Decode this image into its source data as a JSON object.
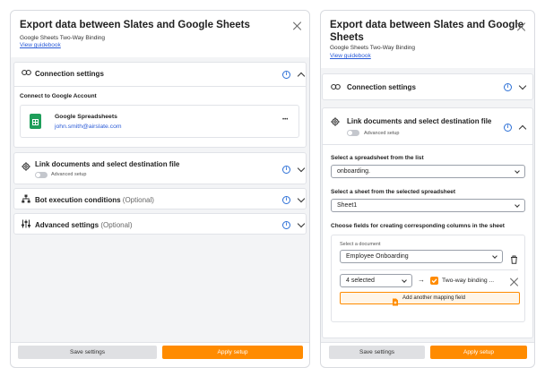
{
  "colors": {
    "accent": "#ff8b00",
    "link": "#2a5bd7",
    "info": "#2b6fd6"
  },
  "left": {
    "title": "Export data between Slates and Google Sheets",
    "subtitle": "Google Sheets Two-Way Binding",
    "guidebook": "View guidebook",
    "connection": {
      "label": "Connection settings",
      "connect_label": "Connect to Google Account",
      "account_name": "Google Spreadsheets",
      "account_email": "john.smith@airslate.com",
      "more": "•••"
    },
    "link_docs": {
      "label": "Link documents and select destination file",
      "toggle_label": "Advanced setup"
    },
    "bot_exec": {
      "label": "Bot execution conditions",
      "optional": "(Optional)"
    },
    "advanced": {
      "label": "Advanced settings",
      "optional": "(Optional)"
    },
    "save": "Save settings",
    "apply": "Apply setup"
  },
  "right": {
    "title_line1": "Export data between Slates and Google",
    "title_line2": "Sheets",
    "subtitle": "Google Sheets Two-Way Binding",
    "guidebook": "View guidebook",
    "connection_label": "Connection settings",
    "link_docs_label": "Link documents and select destination file",
    "toggle_label": "Advanced setup",
    "spreadsheet_label": "Select a spreadsheet from the list",
    "spreadsheet_value": "onboarding.",
    "sheet_label": "Select a sheet from the selected spreadsheet",
    "sheet_value": "Sheet1",
    "fields_label": "Choose fields for creating corresponding columns in the sheet",
    "document_label": "Select a document",
    "document_value": "Employee Onboarding",
    "selected_value": "4 selected",
    "binding_label": "Two-way binding ...",
    "add_mapping": "Add another mapping field",
    "save": "Save settings",
    "apply": "Apply setup"
  }
}
